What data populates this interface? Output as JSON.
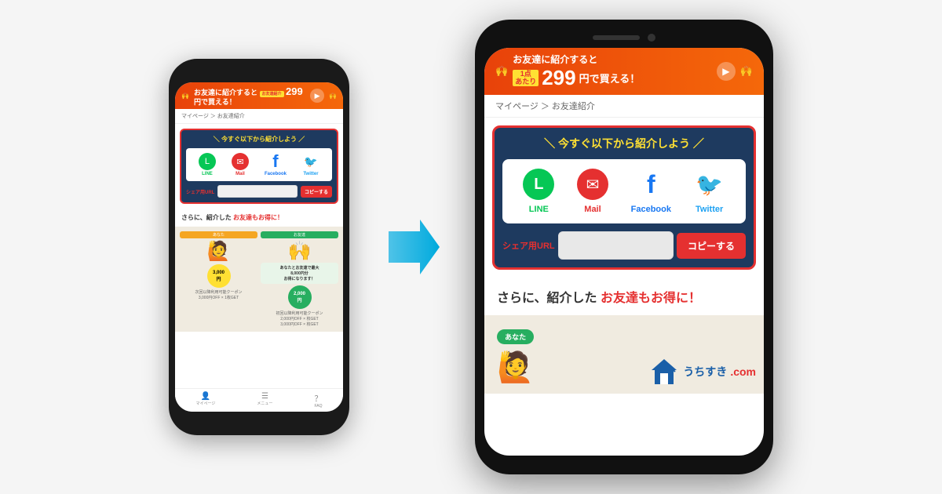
{
  "small_phone": {
    "banner": {
      "pre_text": "お友達に紹介すると",
      "price": "299",
      "unit": "円で買える！",
      "badge": "お友達紹介"
    },
    "breadcrumb": "マイページ ＞ お友達紹介",
    "share_section": {
      "title": "＼ 今すぐ以下から紹介しよう ／",
      "buttons": [
        {
          "id": "line",
          "label": "LINE",
          "icon": "L"
        },
        {
          "id": "mail",
          "label": "Mail",
          "icon": "✉"
        },
        {
          "id": "facebook",
          "label": "Facebook",
          "icon": "f"
        },
        {
          "id": "twitter",
          "label": "Twitter",
          "icon": "🐦"
        }
      ],
      "url_label": "シェア用URL",
      "copy_label": "コピーする"
    },
    "further_text": "さらに、紹介した",
    "further_highlight": "お友達もお得に！",
    "nav": [
      {
        "label": "マイページ",
        "icon": "👤"
      },
      {
        "label": "メニュー",
        "icon": "☰"
      },
      {
        "label": "FAQ",
        "icon": "？"
      }
    ]
  },
  "large_phone": {
    "banner": {
      "pre_text": "お友達に紹介すると",
      "price": "299",
      "unit": "円で買える！",
      "badge_line1": "1点",
      "badge_line2": "あたり"
    },
    "breadcrumb": "マイページ ＞ お友達紹介",
    "share_section": {
      "title": "＼ 今すぐ以下から紹介しよう ／",
      "buttons": [
        {
          "id": "line",
          "label": "LINE",
          "icon": "L"
        },
        {
          "id": "mail",
          "label": "Mail",
          "icon": "✉"
        },
        {
          "id": "facebook",
          "label": "Facebook",
          "icon": "f"
        },
        {
          "id": "twitter",
          "label": "Twitter",
          "icon": "🐦"
        }
      ],
      "url_label": "シェア用URL",
      "copy_label": "コピーする"
    },
    "further_text": "さらに、紹介した",
    "further_highlight": "お友達もお得に！",
    "logo": {
      "text": "うちすき",
      "domain": ".com"
    },
    "anata": "あなた"
  },
  "arrow": "→"
}
